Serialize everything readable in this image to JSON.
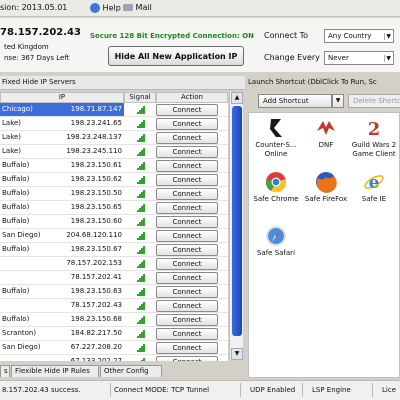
{
  "menubar": {
    "version": "sion: 2013.05.01",
    "help": "Help",
    "mail": "Mail"
  },
  "status_panel": {
    "ip": "78.157.202.43",
    "location": "ted Kingdom",
    "days_left": "Days Left",
    "days_prefix": "nse: 367 Days Left",
    "secure_text": "Secure 128 Bit Encrypted Connection: ON",
    "hide_button": "Hide All New Application IP",
    "connect_to_label": "Connect To",
    "change_every_label": "Change Every",
    "country_value": "Any Country",
    "every_value": "Never"
  },
  "server_list": {
    "header": "Fixed Hide IP Servers",
    "columns": {
      "ip": "IP",
      "signal": "Signal",
      "action": "Action"
    },
    "connect_label": "Connect",
    "rows": [
      {
        "city": "Chicago)",
        "ip": "198.71.87.147",
        "signal": 4,
        "selected": true
      },
      {
        "city": "Lake)",
        "ip": "198.23.241.65",
        "signal": 4
      },
      {
        "city": "Lake)",
        "ip": "198.23.248.137",
        "signal": 4
      },
      {
        "city": "Lake)",
        "ip": "198.23.245.110",
        "signal": 4
      },
      {
        "city": "Buffalo)",
        "ip": "198.23.150.61",
        "signal": 4
      },
      {
        "city": "Buffalo)",
        "ip": "198.23.150.62",
        "signal": 4
      },
      {
        "city": "Buffalo)",
        "ip": "198.23.150.50",
        "signal": 4
      },
      {
        "city": "Buffalo)",
        "ip": "198.23.150.65",
        "signal": 4
      },
      {
        "city": "Buffalo)",
        "ip": "198.23.150.60",
        "signal": 4
      },
      {
        "city": "San Diego)",
        "ip": "204.68.120.110",
        "signal": 4
      },
      {
        "city": "Buffalo)",
        "ip": "198.23.150.67",
        "signal": 4
      },
      {
        "city": "",
        "ip": "78.157.202.153",
        "signal": 4
      },
      {
        "city": "",
        "ip": "78.157.202.41",
        "signal": 4
      },
      {
        "city": "Buffalo)",
        "ip": "198.23.150.63",
        "signal": 4
      },
      {
        "city": "",
        "ip": "78.157.202.43",
        "signal": 4
      },
      {
        "city": "Buffalo)",
        "ip": "198.23.150.68",
        "signal": 4
      },
      {
        "city": "Scranton)",
        "ip": "184.82.217.50",
        "signal": 4
      },
      {
        "city": "San Diego)",
        "ip": "67.227.208.20",
        "signal": 4
      },
      {
        "city": "",
        "ip": "67.133.202.27",
        "signal": 4
      }
    ]
  },
  "tabs": [
    "s",
    "Flexible Hide IP Rules",
    "Other Config"
  ],
  "statusbar": {
    "left": "8.157.202.43 success.",
    "mode": "Connect MODE: TCP Tunnel",
    "udp": "UDP Enabled",
    "lsp": "LSP Engine",
    "last": "Lice"
  },
  "shortcuts_panel": {
    "header": "Launch Shortcut (DblClick To Run, Sc",
    "add_button": "Add Shortcut",
    "delete_button": "Delete Shorto",
    "items": [
      {
        "label": "Counter-S... Online",
        "icon": "counter-strike-icon",
        "color": "#1a1a1a"
      },
      {
        "label": "DNF",
        "icon": "dnf-icon",
        "color": "#c0392b"
      },
      {
        "label": "Guild Wars 2 Game Client",
        "icon": "guild-wars-icon",
        "color": "#c0392b"
      },
      {
        "label": "Safe Chrome",
        "icon": "chrome-icon",
        "color": "#4caf50"
      },
      {
        "label": "Safe FireFox",
        "icon": "firefox-icon",
        "color": "#e8731a"
      },
      {
        "label": "Safe IE",
        "icon": "ie-icon",
        "color": "#1e88e5"
      },
      {
        "label": "Safe Safari",
        "icon": "safari-icon",
        "color": "#4a90d9"
      }
    ]
  }
}
